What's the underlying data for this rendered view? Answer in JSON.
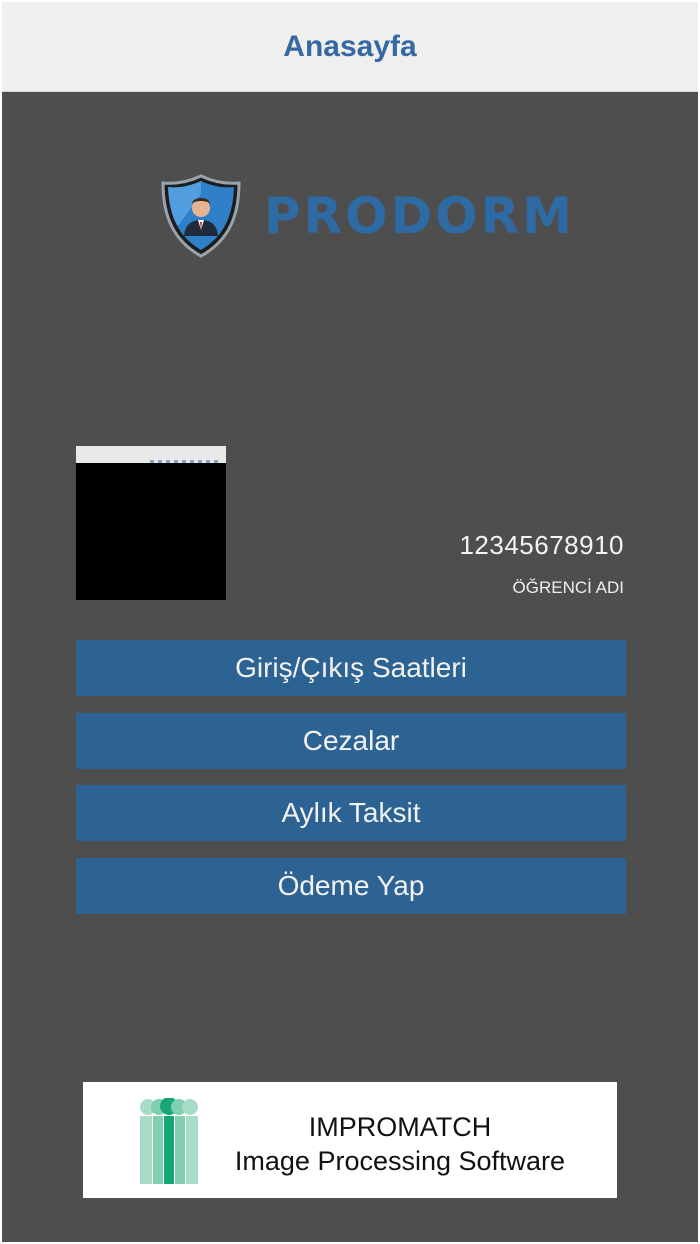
{
  "navbar": {
    "title": "Anasayfa"
  },
  "logo": {
    "text": "PRODORM"
  },
  "student": {
    "number": "12345678910",
    "name": "ÖĞRENCİ ADI"
  },
  "menu": [
    {
      "label": "Giriş/Çıkış Saatleri"
    },
    {
      "label": "Cezalar"
    },
    {
      "label": "Aylık Taksit"
    },
    {
      "label": "Ödeme Yap"
    }
  ],
  "banner": {
    "line1": "IMPROMATCH",
    "line2": "Image Processing Software"
  },
  "colors": {
    "background": "#4e4e4e",
    "navbar": "#efefef",
    "accent": "#2d6393",
    "title": "#3569a1",
    "brand_green": "#1aa67a"
  }
}
